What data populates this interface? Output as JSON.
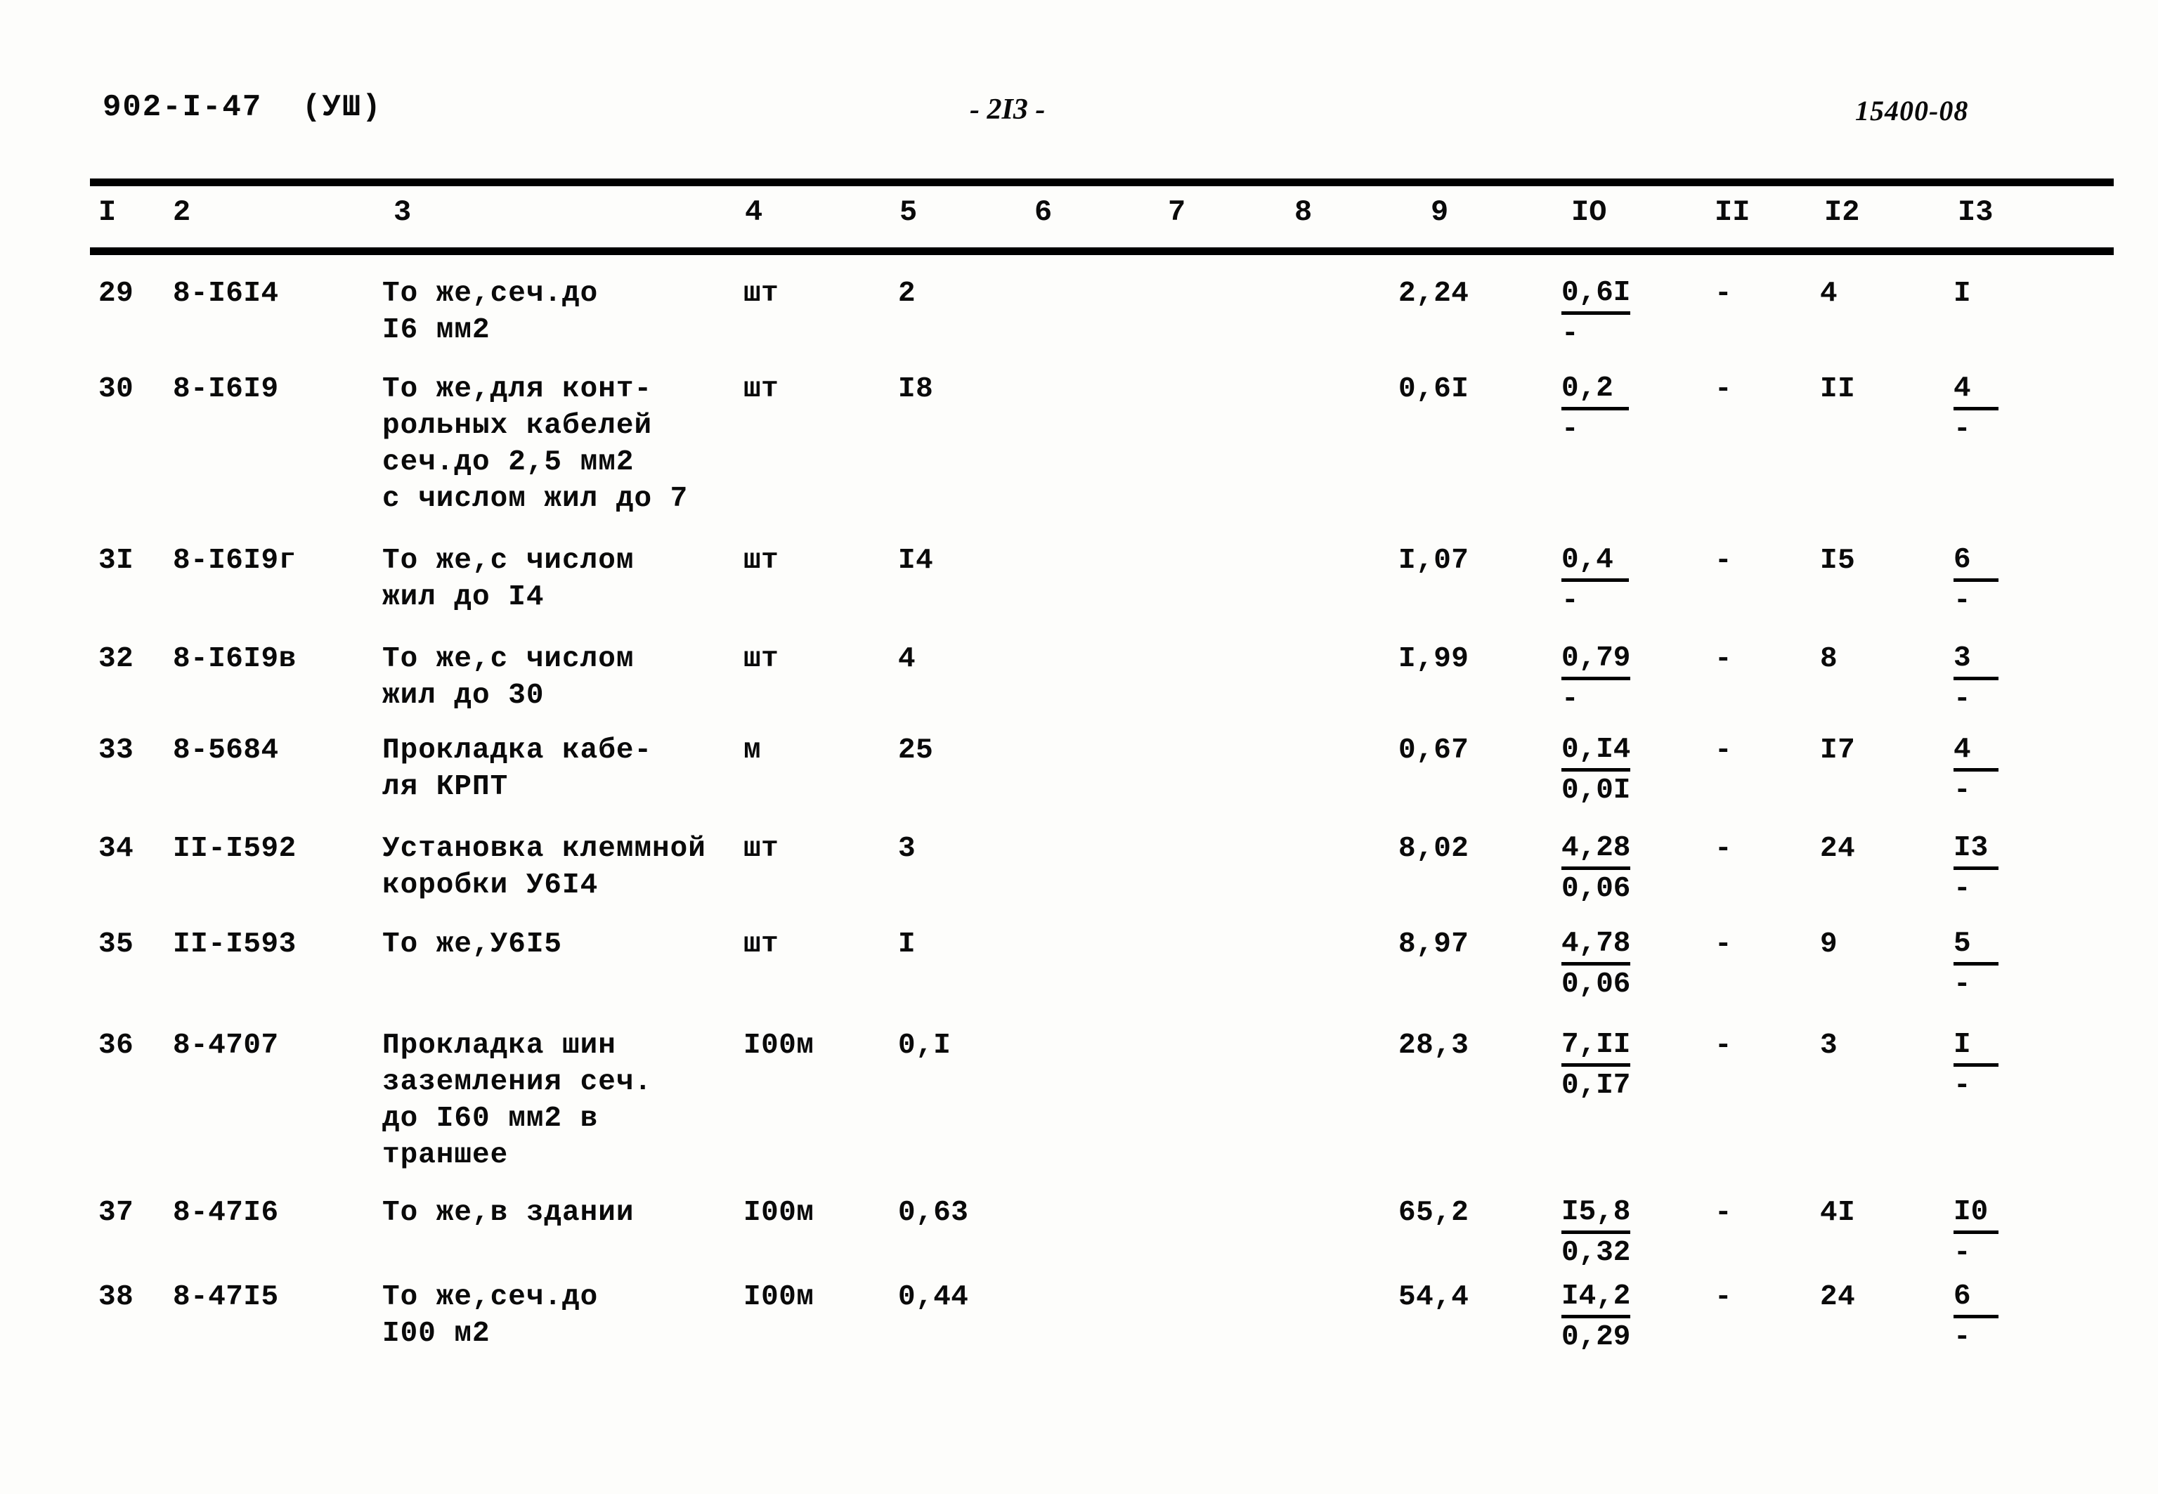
{
  "header": {
    "doc_code": "902-I-47  (УШ)",
    "page_number": "- 2I3 -",
    "sheet_code": "15400-08"
  },
  "table": {
    "column_headers": [
      "I",
      "2",
      "3",
      "4",
      "5",
      "6",
      "7",
      "8",
      "9",
      "IO",
      "II",
      "I2",
      "I3"
    ],
    "rows": [
      {
        "c1": "29",
        "c2": "8-I6I4",
        "c3": "То же,сеч.до\nI6 мм2",
        "c4": "шт",
        "c5": "2",
        "c9": "2,24",
        "c10_top": "0,6I",
        "c10_bot": "-",
        "c11": "-",
        "c12": "4",
        "c13_top": "I",
        "c13_bot": ""
      },
      {
        "c1": "30",
        "c2": "8-I6I9",
        "c3": "То же,для конт-\nрольных кабелей\nсеч.до 2,5 мм2\nс числом жил до 7",
        "c4": "шт",
        "c5": "I8",
        "c9": "0,6I",
        "c10_top": "0,2",
        "c10_bot": "-",
        "c11": "-",
        "c12": "II",
        "c13_top": "4",
        "c13_bot": "-"
      },
      {
        "c1": "3I",
        "c2": "8-I6I9г",
        "c3": "То же,с числом\nжил до I4",
        "c4": "шт",
        "c5": "I4",
        "c9": "I,07",
        "c10_top": "0,4",
        "c10_bot": "-",
        "c11": "-",
        "c12": "I5",
        "c13_top": "6",
        "c13_bot": "-"
      },
      {
        "c1": "32",
        "c2": "8-I6I9в",
        "c3": "То же,с числом\nжил до 30",
        "c4": "шт",
        "c5": "4",
        "c9": "I,99",
        "c10_top": "0,79",
        "c10_bot": "-",
        "c11": "-",
        "c12": "8",
        "c13_top": "3",
        "c13_bot": "-"
      },
      {
        "c1": "33",
        "c2": "8-5684",
        "c3": "Прокладка кабе-\nля КРПТ",
        "c4": "м",
        "c5": "25",
        "c9": "0,67",
        "c10_top": "0,I4",
        "c10_bot": "0,0I",
        "c11": "-",
        "c12": "I7",
        "c13_top": "4",
        "c13_bot": "-"
      },
      {
        "c1": "34",
        "c2": "II-I592",
        "c3": "Установка клеммной\nкоробки У6I4",
        "c4": "шт",
        "c5": "3",
        "c9": "8,02",
        "c10_top": "4,28",
        "c10_bot": "0,06",
        "c11": "-",
        "c12": "24",
        "c13_top": "I3",
        "c13_bot": "-"
      },
      {
        "c1": "35",
        "c2": "II-I593",
        "c3": "То же,У6I5",
        "c4": "шт",
        "c5": "I",
        "c9": "8,97",
        "c10_top": "4,78",
        "c10_bot": "0,06",
        "c11": "-",
        "c12": "9",
        "c13_top": "5",
        "c13_bot": "-"
      },
      {
        "c1": "36",
        "c2": "8-4707",
        "c3": "Прокладка шин\nзаземления сеч.\nдо I60 мм2 в\nтраншее",
        "c4": "I00м",
        "c5": "0,I",
        "c9": "28,3",
        "c10_top": "7,II",
        "c10_bot": "0,I7",
        "c11": "-",
        "c12": "3",
        "c13_top": "I",
        "c13_bot": "-"
      },
      {
        "c1": "37",
        "c2": "8-47I6",
        "c3": "То же,в здании",
        "c4": "I00м",
        "c5": "0,63",
        "c9": "65,2",
        "c10_top": "I5,8",
        "c10_bot": "0,32",
        "c11": "-",
        "c12": "4I",
        "c13_top": "I0",
        "c13_bot": "-"
      },
      {
        "c1": "38",
        "c2": "8-47I5",
        "c3": "То же,сеч.до\nI00 м2",
        "c4": "I00м",
        "c5": "0,44",
        "c9": "54,4",
        "c10_top": "I4,2",
        "c10_bot": "0,29",
        "c11": "-",
        "c12": "24",
        "c13_top": "6",
        "c13_bot": "-"
      }
    ]
  }
}
